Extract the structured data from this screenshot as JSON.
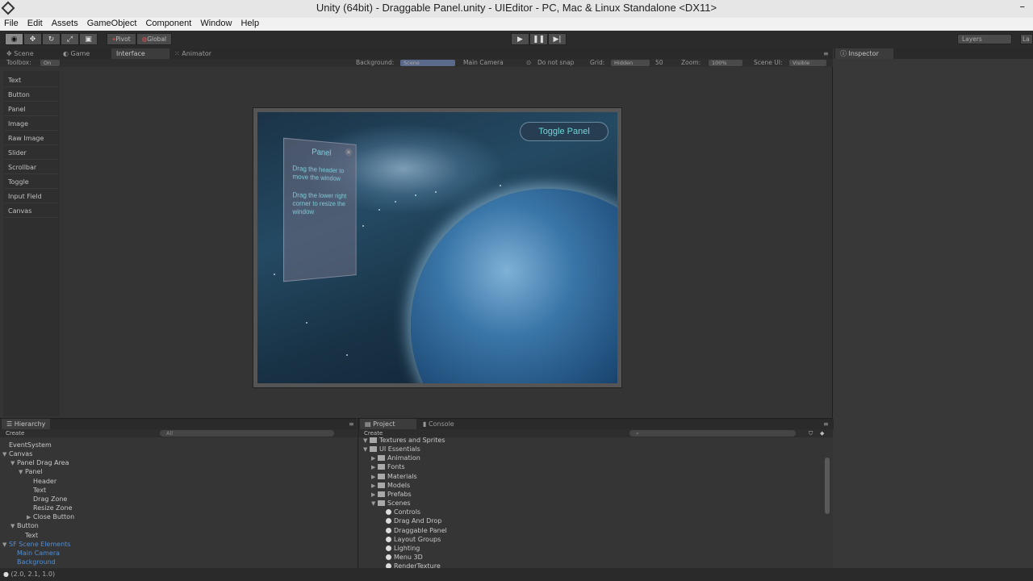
{
  "window": {
    "title": "Unity (64bit) - Draggable Panel.unity - UIEditor - PC, Mac & Linux Standalone <DX11>",
    "minimize": "–"
  },
  "menu": [
    "File",
    "Edit",
    "Assets",
    "GameObject",
    "Component",
    "Window",
    "Help"
  ],
  "toolbar": {
    "pivot": "Pivot",
    "global": "Global",
    "layers": "Layers",
    "layout": "La"
  },
  "tabs": {
    "scene": "Scene",
    "game": "Game",
    "interface": "Interface",
    "animator": "Animator",
    "inspector": "Inspector",
    "hierarchy": "Hierarchy",
    "project": "Project",
    "console": "Console"
  },
  "scene_bar": {
    "toolbox_label": "Toolbox:",
    "toolbox_value": "On",
    "background_label": "Background:",
    "background_value": "Scene",
    "camera": "Main Camera",
    "snap": "Do not snap",
    "grid_label": "Grid:",
    "grid_value": "Hidden",
    "grid_size": "50",
    "zoom_label": "Zoom:",
    "zoom_value": "100%",
    "sceneui_label": "Scene UI:",
    "sceneui_value": "Visible"
  },
  "toolbox_items": [
    "Text",
    "Button",
    "Panel",
    "Image",
    "Raw Image",
    "Slider",
    "Scrollbar",
    "Toggle",
    "Input Field",
    "Canvas"
  ],
  "game": {
    "toggle_button": "Toggle Panel",
    "panel_title": "Panel",
    "panel_text1": "Drag the header to move the window",
    "panel_text2": "Drag the lower right corner to resize the window"
  },
  "hierarchy": {
    "create": "Create",
    "search": "All",
    "items": [
      {
        "label": "EventSystem",
        "depth": 0,
        "expanded": null,
        "blue": false
      },
      {
        "label": "Canvas",
        "depth": 0,
        "expanded": true,
        "blue": false
      },
      {
        "label": "Panel Drag Area",
        "depth": 1,
        "expanded": true,
        "blue": false
      },
      {
        "label": "Panel",
        "depth": 2,
        "expanded": true,
        "blue": false
      },
      {
        "label": "Header",
        "depth": 3,
        "expanded": null,
        "blue": false
      },
      {
        "label": "Text",
        "depth": 3,
        "expanded": null,
        "blue": false
      },
      {
        "label": "Drag Zone",
        "depth": 3,
        "expanded": null,
        "blue": false
      },
      {
        "label": "Resize Zone",
        "depth": 3,
        "expanded": null,
        "blue": false
      },
      {
        "label": "Close Button",
        "depth": 3,
        "expanded": false,
        "blue": false
      },
      {
        "label": "Button",
        "depth": 1,
        "expanded": true,
        "blue": false
      },
      {
        "label": "Text",
        "depth": 2,
        "expanded": null,
        "blue": false
      },
      {
        "label": "SF Scene Elements",
        "depth": 0,
        "expanded": true,
        "blue": true
      },
      {
        "label": "Main Camera",
        "depth": 1,
        "expanded": null,
        "blue": true
      },
      {
        "label": "Background",
        "depth": 1,
        "expanded": null,
        "blue": true
      }
    ]
  },
  "project": {
    "create": "Create",
    "items": [
      {
        "label": "Textures and Sprites",
        "depth": 0,
        "type": "folder",
        "expanded": true
      },
      {
        "label": "UI Essentials",
        "depth": 0,
        "type": "folder",
        "expanded": true
      },
      {
        "label": "Animation",
        "depth": 1,
        "type": "folder",
        "expanded": false
      },
      {
        "label": "Fonts",
        "depth": 1,
        "type": "folder",
        "expanded": false
      },
      {
        "label": "Materials",
        "depth": 1,
        "type": "folder",
        "expanded": false
      },
      {
        "label": "Models",
        "depth": 1,
        "type": "folder",
        "expanded": false
      },
      {
        "label": "Prefabs",
        "depth": 1,
        "type": "folder",
        "expanded": false
      },
      {
        "label": "Scenes",
        "depth": 1,
        "type": "folder",
        "expanded": true
      },
      {
        "label": "Controls",
        "depth": 2,
        "type": "scene",
        "expanded": null
      },
      {
        "label": "Drag And Drop",
        "depth": 2,
        "type": "scene",
        "expanded": null
      },
      {
        "label": "Draggable Panel",
        "depth": 2,
        "type": "scene",
        "expanded": null
      },
      {
        "label": "Layout Groups",
        "depth": 2,
        "type": "scene",
        "expanded": null
      },
      {
        "label": "Lighting",
        "depth": 2,
        "type": "scene",
        "expanded": null
      },
      {
        "label": "Menu 3D",
        "depth": 2,
        "type": "scene",
        "expanded": null
      },
      {
        "label": "RenderTexture",
        "depth": 2,
        "type": "scene",
        "expanded": null
      }
    ]
  },
  "status": "(2.0, 2.1, 1.0)"
}
